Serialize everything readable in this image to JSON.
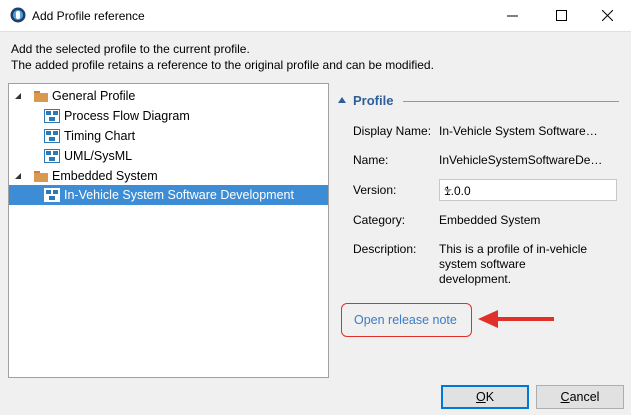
{
  "window": {
    "title": "Add Profile reference",
    "controls": {
      "minimize": "minimize-icon",
      "maximize": "maximize-icon",
      "close": "close-icon"
    }
  },
  "description": {
    "line1": "Add the selected profile to the current profile.",
    "line2": "The added profile retains a reference to the original profile and can be modified."
  },
  "tree": [
    {
      "label": "General Profile",
      "type": "folder",
      "expanded": true
    },
    {
      "label": "Process Flow Diagram",
      "type": "profile"
    },
    {
      "label": "Timing Chart",
      "type": "profile"
    },
    {
      "label": "UML/SysML",
      "type": "profile"
    },
    {
      "label": "Embedded System",
      "type": "folder",
      "expanded": true
    },
    {
      "label": "In-Vehicle System Software Development",
      "type": "profile",
      "selected": true
    }
  ],
  "profile": {
    "header": "Profile",
    "display_name_label": "Display Name:",
    "display_name_value": "In-Vehicle System Software…",
    "name_label": "Name:",
    "name_value": "InVehicleSystemSoftwareDe…",
    "version_label": "Version:",
    "version_value": "1.0.0",
    "category_label": "Category:",
    "category_value": "Embedded System",
    "description_label": "Description:",
    "description_lines": [
      "This is a profile of in-vehicle",
      "system software",
      "development."
    ],
    "release_note_link": "Open release note"
  },
  "buttons": {
    "ok_mnemonic": "O",
    "ok_rest": "K",
    "cancel_mnemonic": "C",
    "cancel_rest": "ancel"
  },
  "colors": {
    "selection": "#3c8dd5",
    "header_blue": "#2f5f98",
    "link": "#3a7cc7",
    "highlight_red": "#e0302a"
  }
}
